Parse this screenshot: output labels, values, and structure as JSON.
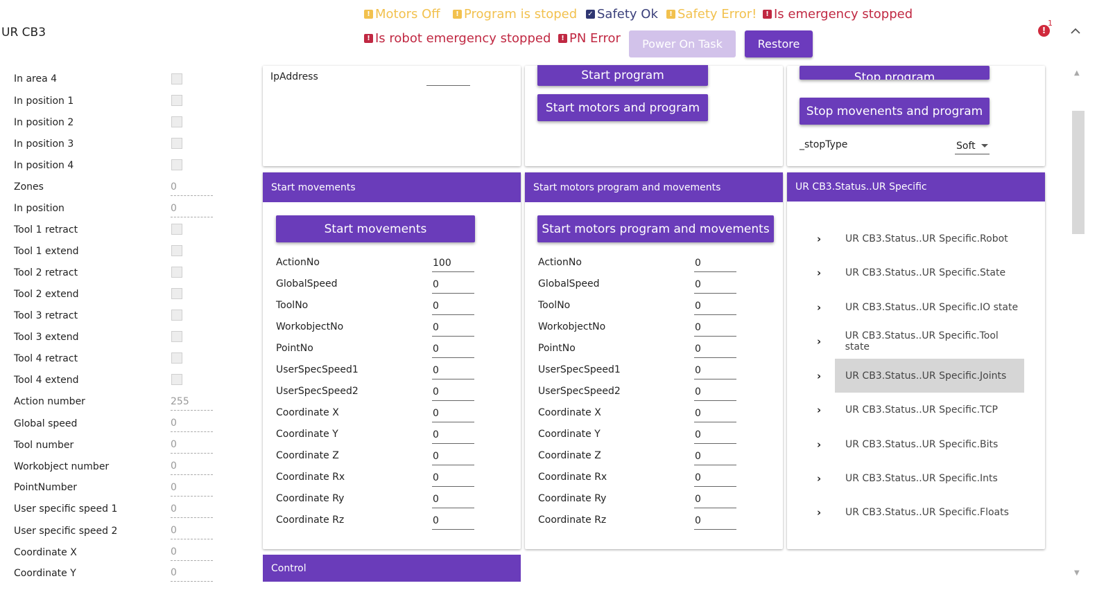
{
  "app": {
    "title": "UR CB3"
  },
  "status": {
    "motors_off": "Motors Off",
    "program_stoped": "Program is stoped",
    "safety_ok": "Safety Ok",
    "safety_error": "Safety Error!",
    "emergency": "Is emergency stopped",
    "robot_emergency": "Is robot emergency stopped",
    "pn_error": "PN Error"
  },
  "header": {
    "power_on_task": "Power On Task",
    "restore": "Restore",
    "notification_count": "1"
  },
  "left": {
    "in_area_4": "In area 4",
    "in_position_1": "In position 1",
    "in_position_2": "In position 2",
    "in_position_3": "In position 3",
    "in_position_4": "In position 4",
    "zones": "Zones",
    "zones_val": "0",
    "in_position": "In position",
    "in_position_val": "0",
    "tool1_retract": "Tool 1 retract",
    "tool1_extend": "Tool 1 extend",
    "tool2_retract": "Tool 2 retract",
    "tool2_extend": "Tool 2 extend",
    "tool3_retract": "Tool 3 retract",
    "tool3_extend": "Tool 3 extend",
    "tool4_retract": "Tool 4 retract",
    "tool4_extend": "Tool 4 extend",
    "action_number": "Action number",
    "action_number_val": "255",
    "global_speed": "Global speed",
    "global_speed_val": "0",
    "tool_number": "Tool number",
    "tool_number_val": "0",
    "workobject_number": "Workobject number",
    "workobject_number_val": "0",
    "point_number": "PointNumber",
    "point_number_val": "0",
    "user_speed_1": "User specific speed 1",
    "user_speed_1_val": "0",
    "user_speed_2": "User specific speed 2",
    "user_speed_2_val": "0",
    "coord_x": "Coordinate X",
    "coord_x_val": "0",
    "coord_y": "Coordinate Y",
    "coord_y_val": "0"
  },
  "top": {
    "ip_label": "IpAddress",
    "ip_value": "",
    "start_program": "Start program",
    "start_motors_program": "Start motors and program",
    "stop_program": "Stop program",
    "stop_movements_program": "Stop movenents and program",
    "stop_type_label": "_stopType",
    "stop_type_value": "Soft"
  },
  "start_movements": {
    "header": "Start movements",
    "button": "Start movements",
    "fields": {
      "action_no": {
        "label": "ActionNo",
        "value": "100"
      },
      "global_speed": {
        "label": "GlobalSpeed",
        "value": "0"
      },
      "tool_no": {
        "label": "ToolNo",
        "value": "0"
      },
      "workobject_no": {
        "label": "WorkobjectNo",
        "value": "0"
      },
      "point_no": {
        "label": "PointNo",
        "value": "0"
      },
      "user_speed_1": {
        "label": "UserSpecSpeed1",
        "value": "0"
      },
      "user_speed_2": {
        "label": "UserSpecSpeed2",
        "value": "0"
      },
      "coord_x": {
        "label": "Coordinate X",
        "value": "0"
      },
      "coord_y": {
        "label": "Coordinate Y",
        "value": "0"
      },
      "coord_z": {
        "label": "Coordinate Z",
        "value": "0"
      },
      "coord_rx": {
        "label": "Coordinate Rx",
        "value": "0"
      },
      "coord_ry": {
        "label": "Coordinate Ry",
        "value": "0"
      },
      "coord_rz": {
        "label": "Coordinate Rz",
        "value": "0"
      }
    }
  },
  "start_motors_program_movements": {
    "header": "Start motors program and movements",
    "button": "Start motors program and movements",
    "fields": {
      "action_no": {
        "label": "ActionNo",
        "value": "0"
      },
      "global_speed": {
        "label": "GlobalSpeed",
        "value": "0"
      },
      "tool_no": {
        "label": "ToolNo",
        "value": "0"
      },
      "workobject_no": {
        "label": "WorkobjectNo",
        "value": "0"
      },
      "point_no": {
        "label": "PointNo",
        "value": "0"
      },
      "user_speed_1": {
        "label": "UserSpecSpeed1",
        "value": "0"
      },
      "user_speed_2": {
        "label": "UserSpecSpeed2",
        "value": "0"
      },
      "coord_x": {
        "label": "Coordinate X",
        "value": "0"
      },
      "coord_y": {
        "label": "Coordinate Y",
        "value": "0"
      },
      "coord_z": {
        "label": "Coordinate Z",
        "value": "0"
      },
      "coord_rx": {
        "label": "Coordinate Rx",
        "value": "0"
      },
      "coord_ry": {
        "label": "Coordinate Ry",
        "value": "0"
      },
      "coord_rz": {
        "label": "Coordinate Rz",
        "value": "0"
      }
    }
  },
  "ur_specific": {
    "header": "UR CB3.Status..UR Specific",
    "items": {
      "robot": "UR CB3.Status..UR Specific.Robot",
      "state": "UR CB3.Status..UR Specific.State",
      "io_state": "UR CB3.Status..UR Specific.IO state",
      "tool_state": "UR CB3.Status..UR Specific.Tool state",
      "joints": "UR CB3.Status..UR Specific.Joints",
      "tcp": "UR CB3.Status..UR Specific.TCP",
      "bits": "UR CB3.Status..UR Specific.Bits",
      "ints": "UR CB3.Status..UR Specific.Ints",
      "floats": "UR CB3.Status..UR Specific.Floats"
    }
  },
  "control": {
    "header": "Control"
  },
  "icons": {
    "warning": "warning-icon",
    "check": "checkbox-checked-icon",
    "error": "error-icon",
    "chevron": "chevron-right-icon",
    "collapse": "chevron-up-icon",
    "notification": "notification-error-icon"
  },
  "colors": {
    "accent": "#6a3cba",
    "warning": "#f2c14e",
    "error": "#c02842",
    "ok": "#2f3672"
  }
}
